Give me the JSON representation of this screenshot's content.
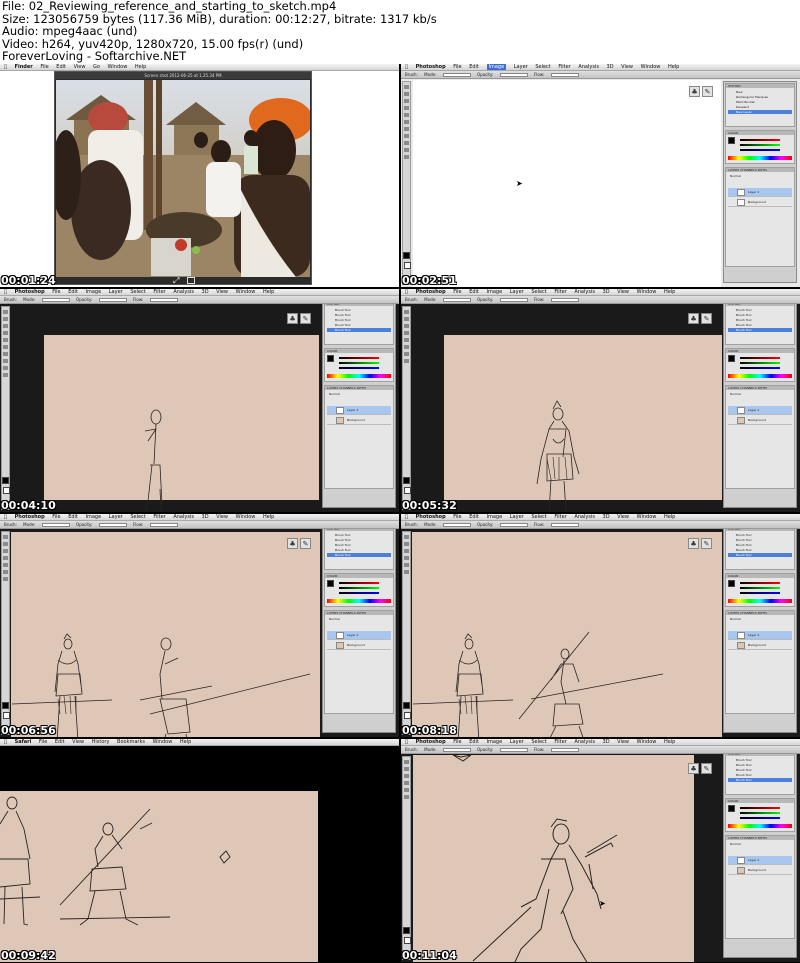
{
  "header": {
    "file": "File: 02_Reviewing_reference_and_starting_to_sketch.mp4",
    "size": "Size: 123056759 bytes (117.36 MiB), duration: 00:12:27, bitrate: 1317 kb/s",
    "audio": "Audio: mpeg4aac (und)",
    "video": "Video: h264, yuv420p, 1280x720, 15.00 fps(r) (und)",
    "credit": "ForeverLoving - Softarchive.NET"
  },
  "menus": {
    "finder": [
      "Finder",
      "File",
      "Edit",
      "View",
      "Go",
      "Window",
      "Help"
    ],
    "photoshop": [
      "Photoshop",
      "File",
      "Edit",
      "Image",
      "Layer",
      "Select",
      "Filter",
      "Analysis",
      "3D",
      "View",
      "Window",
      "Help"
    ],
    "safari": [
      "Safari",
      "File",
      "Edit",
      "View",
      "History",
      "Bookmarks",
      "Window",
      "Help"
    ]
  },
  "options_bar": {
    "brush_label": "Brush:",
    "mode_label": "Mode:",
    "mode_value": "Normal",
    "opacity_label": "Opacity:",
    "opacity_value": "100%",
    "flow_label": "Flow:",
    "flow_value": "100%"
  },
  "finder_window_title": "Screen shot 2012-06-25 at 1.25.34 PM",
  "panels": {
    "history_tab": "HISTORY",
    "history_items_first": [
      "New",
      "Rectangular Marquee",
      "Paint Bucket",
      "Deselect",
      "New Layer"
    ],
    "history_items_brush": [
      "Brush Tool",
      "Brush Tool",
      "Brush Tool",
      "Brush Tool",
      "Brush Tool"
    ],
    "color_tab": "COLOR",
    "color_channels": [
      "R",
      "G",
      "B"
    ],
    "color_values": [
      "0",
      "0",
      "0"
    ],
    "layers_tab": "LAYERS",
    "layers_tab2": "CHANNELS",
    "layers_tab3": "PATHS",
    "layers_mode": "Normal",
    "layers_opacity": "100%",
    "layers_fill": "100%",
    "layer_names": [
      "Layer 1",
      "Background"
    ]
  },
  "timestamps": [
    "00:01:24",
    "00:02:51",
    "00:04:10",
    "00:05:32",
    "00:06:56",
    "00:08:18",
    "00:09:42",
    "00:11:04"
  ],
  "colors": {
    "sketch_bg": "#dfc7b8",
    "sketch_line": "#2a2420",
    "selection_blue": "#4b80d8",
    "panel_grey": "#cfcfcf"
  }
}
